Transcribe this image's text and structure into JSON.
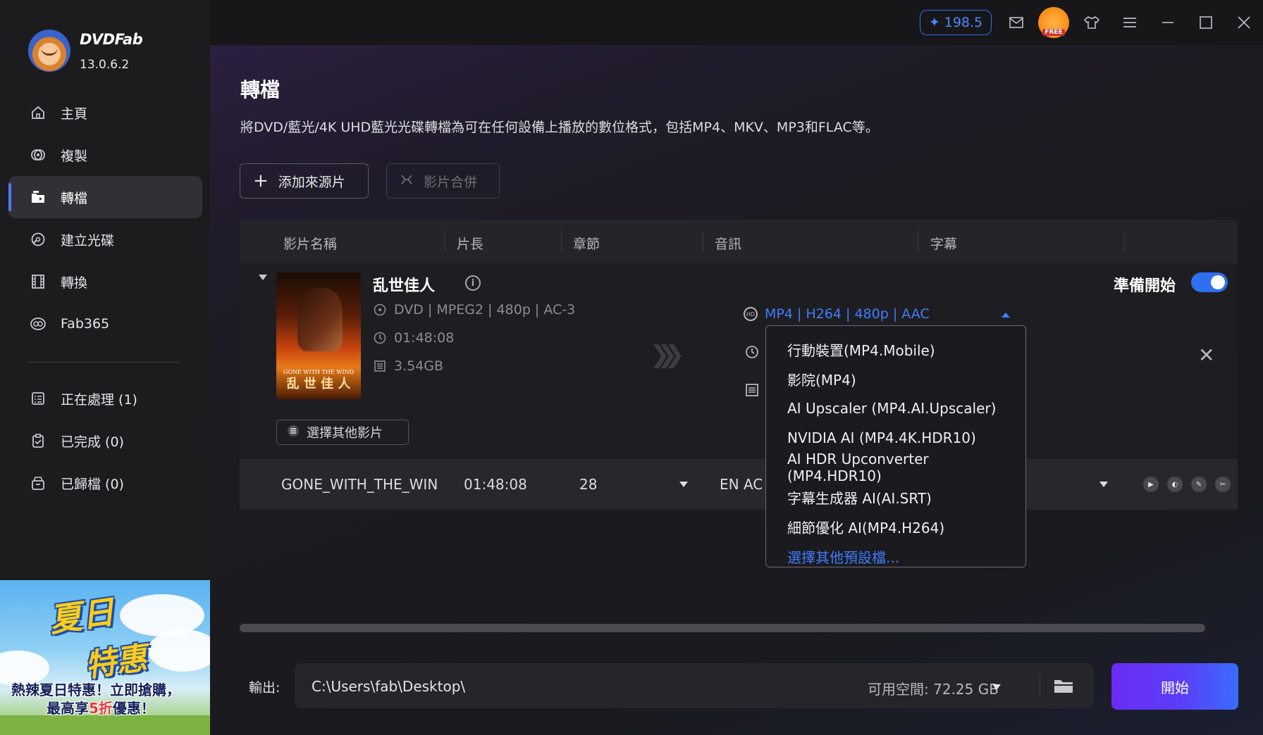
{
  "app": {
    "brand": "DVDFab",
    "version": "13.0.6.2",
    "credits": "198.5",
    "free_badge": "FREE"
  },
  "sidebar": {
    "items": [
      {
        "label": "主頁",
        "icon": "home-icon"
      },
      {
        "label": "複製",
        "icon": "copy-disc-icon"
      },
      {
        "label": "轉檔",
        "icon": "convert-folder-icon",
        "active": true
      },
      {
        "label": "建立光碟",
        "icon": "create-disc-icon"
      },
      {
        "label": "轉換",
        "icon": "film-icon"
      },
      {
        "label": "Fab365",
        "icon": "fab365-icon"
      }
    ],
    "queue": [
      {
        "label": "正在處理 (1)",
        "icon": "processing-icon"
      },
      {
        "label": "已完成 (0)",
        "icon": "completed-icon"
      },
      {
        "label": "已歸檔 (0)",
        "icon": "archive-icon"
      }
    ]
  },
  "promo": {
    "title_line1": "夏日",
    "title_line2": "特惠",
    "line1": "熱辣夏日特惠！立即搶購，",
    "line2_pre": "最高享",
    "line2_hl": "5折",
    "line2_post": "優惠！"
  },
  "page": {
    "title": "轉檔",
    "description": "將DVD/藍光/4K UHD藍光光碟轉檔為可在任何設備上播放的數位格式，包括MP4、MKV、MP3和FLAC等。",
    "add_source": "添加來源片",
    "merge": "影片合併"
  },
  "table": {
    "headers": [
      "影片名稱",
      "片長",
      "章節",
      "音訊",
      "字幕"
    ]
  },
  "movie": {
    "title": "乱世佳人",
    "source_info": "DVD | MPEG2 | 480p | AC-3",
    "duration": "01:48:08",
    "size": "3.54GB",
    "select_other": "選擇其他影片",
    "profile": "MP4 | H264 | 480p | AAC",
    "ready_label": "準備開始",
    "poster_caption": "乱 世 佳 人",
    "poster_small": "GONE WITH THE WIND"
  },
  "row": {
    "name": "GONE_WITH_THE_WIN",
    "duration": "01:48:08",
    "chapters": "28",
    "audio": "EN AC"
  },
  "dropdown": {
    "items": [
      "行動裝置(MP4.Mobile)",
      "影院(MP4)",
      "AI Upscaler (MP4.AI.Upscaler)",
      "NVIDIA AI (MP4.4K.HDR10)",
      "AI HDR Upconverter (MP4.HDR10)",
      "字幕生成器 AI(AI.SRT)",
      "細節優化 AI(MP4.H264)"
    ],
    "more": "選擇其他預設檔..."
  },
  "output": {
    "label": "輸出:",
    "path": "C:\\Users\\fab\\Desktop\\",
    "space": "可用空間: 72.25 GB",
    "start": "開始"
  },
  "colors": {
    "accent": "#2f6ff0",
    "link": "#3f7dff",
    "start_gradient": [
      "#6b2cf5",
      "#3a6cff"
    ]
  }
}
